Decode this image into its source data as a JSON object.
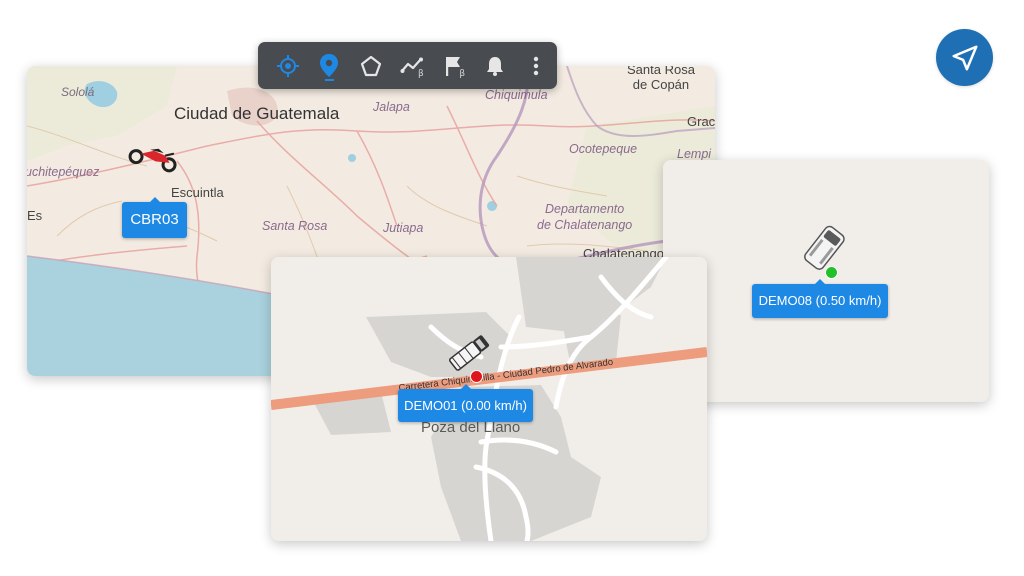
{
  "toolbar": {
    "items": [
      {
        "icon": "crosshair-icon",
        "beta": ""
      },
      {
        "icon": "location-pin-icon",
        "beta": ""
      },
      {
        "icon": "polygon-icon",
        "beta": ""
      },
      {
        "icon": "route-icon",
        "beta": "β"
      },
      {
        "icon": "flag-icon",
        "beta": "β"
      },
      {
        "icon": "bell-icon",
        "beta": ""
      },
      {
        "icon": "more-vertical-icon",
        "beta": ""
      }
    ],
    "active_index": 1,
    "accent_color": "#1e88e5",
    "background_color": "#484c51"
  },
  "nav_button": {
    "icon": "navigation-arrow-icon",
    "color": "#1f6fb4"
  },
  "map_large": {
    "places": {
      "ciudad_de_guatemala": "Ciudad de Guatemala",
      "solola": "Sololá",
      "jalapa": "Jalapa",
      "chiquimula": "Chiquimula",
      "santa_rosa_de_copan": "Santa Rosa\nde Copán",
      "grac": "Grac",
      "lempi": "Lempi",
      "ocotepeque": "Ocotepeque",
      "suchitepequez": "uchitepéquez",
      "escuintla": "Escuintla",
      "es": "Es",
      "santa_rosa": "Santa Rosa",
      "jutiapa": "Jutiapa",
      "departamento_de_chalatenango": "Departamento\nde Chalatenango",
      "chalatenango": "Chalatenango"
    },
    "vehicle_label": "CBR03",
    "vehicle_icon": "motorcycle-icon"
  },
  "map_right": {
    "vehicle_label": "DEMO08 (0.50 km/h)",
    "vehicle_icon": "van-icon",
    "status_color": "#22c02a"
  },
  "map_bottom": {
    "road_label": "Carretera Chiquimulilla - Ciudad Pedro de Alvarado",
    "place": "Poza del Llano",
    "vehicle_label": "DEMO01 (0.00 km/h)",
    "vehicle_icon": "truck-icon",
    "status_color": "#e0141b"
  }
}
